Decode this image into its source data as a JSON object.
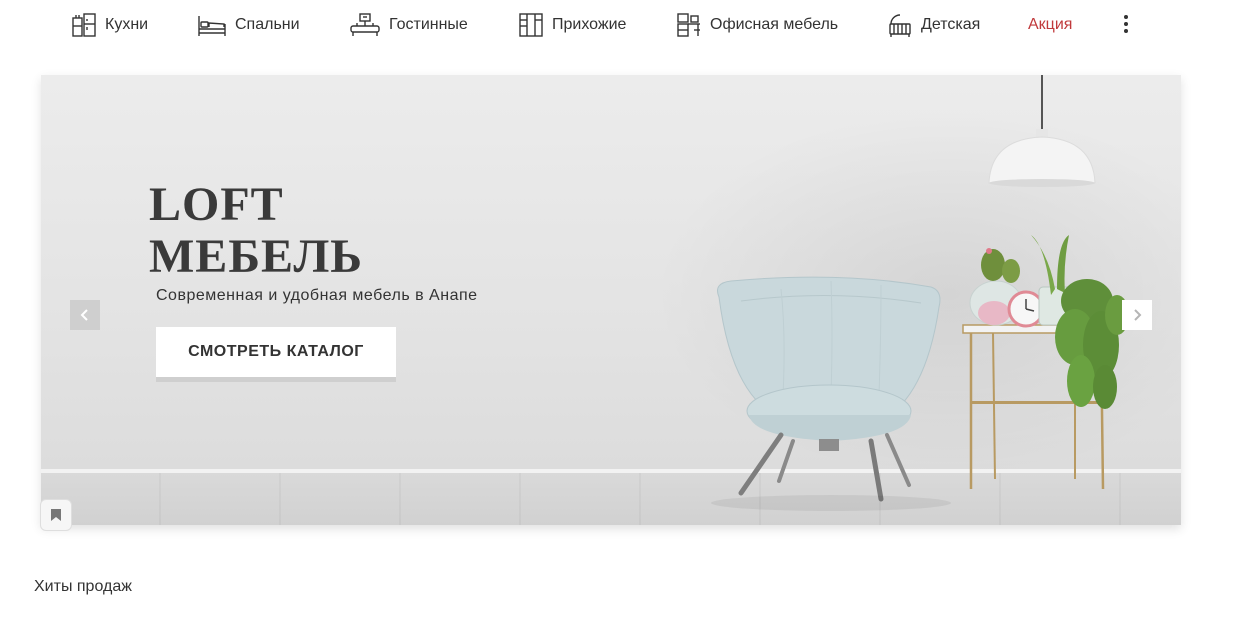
{
  "nav": {
    "items": [
      {
        "label": "Кухни",
        "icon": "kitchen-icon"
      },
      {
        "label": "Спальни",
        "icon": "bed-icon"
      },
      {
        "label": "Гостинные",
        "icon": "living-room-icon"
      },
      {
        "label": "Прихожие",
        "icon": "wardrobe-icon"
      },
      {
        "label": "Офисная мебель",
        "icon": "office-furniture-icon"
      },
      {
        "label": "Детская",
        "icon": "crib-icon"
      }
    ],
    "promo_label": "Акция",
    "more_icon": "more-vertical-icon"
  },
  "hero": {
    "title_line1": "LOFT",
    "title_line2": "МЕБЕЛЬ",
    "subtitle": "Современная и удобная мебель в Анапе",
    "cta_label": "СМОТРЕТЬ КАТАЛОГ",
    "prev_icon": "chevron-left-icon",
    "next_icon": "chevron-right-icon",
    "bookmark_icon": "bookmark-icon"
  },
  "section": {
    "title": "Хиты продаж"
  },
  "colors": {
    "text": "#333333",
    "promo": "#c0393b",
    "hero_bg": "#e6e6e6",
    "chair": "#c9d8dc",
    "brass": "#b89a62"
  }
}
